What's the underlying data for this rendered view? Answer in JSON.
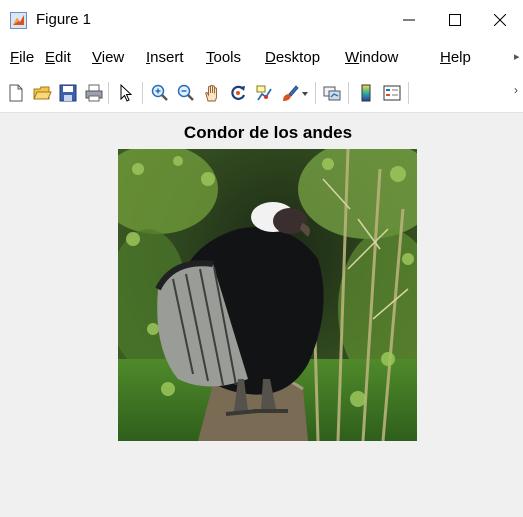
{
  "window": {
    "title": "Figure 1",
    "minimize_glyph": "minimize-icon",
    "maximize_glyph": "maximize-icon",
    "close_glyph": "close-icon"
  },
  "menu": {
    "items": [
      {
        "accel": "F",
        "rest": "ile"
      },
      {
        "accel": "E",
        "rest": "dit"
      },
      {
        "accel": "V",
        "rest": "iew"
      },
      {
        "accel": "I",
        "rest": "nsert"
      },
      {
        "accel": "T",
        "rest": "ools"
      },
      {
        "accel": "D",
        "rest": "esktop"
      },
      {
        "accel": "W",
        "rest": "indow"
      },
      {
        "accel": "H",
        "rest": "elp"
      }
    ],
    "overflow_icon": "overflow-arrow-icon"
  },
  "toolbar": {
    "icons": [
      "new-figure-icon",
      "open-file-icon",
      "save-icon",
      "print-icon",
      "pointer-icon",
      "zoom-in-icon",
      "zoom-out-icon",
      "pan-hand-icon",
      "rotate-3d-icon",
      "data-cursor-icon",
      "brush-icon",
      "dropdown-arrow-icon",
      "link-plot-icon",
      "colorbar-icon",
      "legend-icon"
    ],
    "overflow_glyph": "›"
  },
  "axes": {
    "title": "Condor de los andes",
    "image_subject": "Andean condor perched on a log"
  },
  "colors": {
    "matlab_icon_orange": "#d9531e",
    "background": "#f0f0f0",
    "bars": "#ffffff"
  }
}
